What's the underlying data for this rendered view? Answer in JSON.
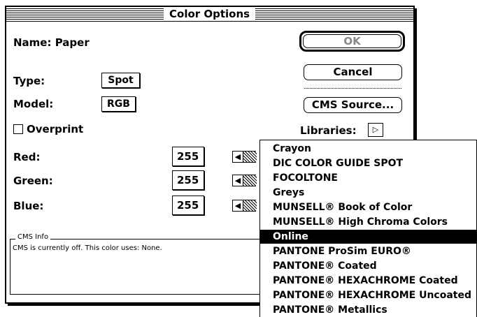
{
  "window": {
    "title": "Color Options"
  },
  "name": {
    "label": "Name: Paper"
  },
  "type": {
    "label": "Type:",
    "value": "Spot"
  },
  "model": {
    "label": "Model:",
    "value": "RGB"
  },
  "overprint": {
    "label": "Overprint",
    "checked": false
  },
  "channels": [
    {
      "label": "Red:",
      "value": "255"
    },
    {
      "label": "Green:",
      "value": "255"
    },
    {
      "label": "Blue:",
      "value": "255"
    }
  ],
  "buttons": {
    "ok": "OK",
    "cancel": "Cancel",
    "cms_source": "CMS Source..."
  },
  "libraries": {
    "label": "Libraries:"
  },
  "cms_info": {
    "legend": "CMS Info",
    "text": "CMS is currently off. This color uses: None."
  },
  "menu": {
    "selected_index": 6,
    "items": [
      "Crayon",
      "DIC COLOR GUIDE SPOT",
      "FOCOLTONE",
      "Greys",
      "MUNSELL® Book of Color",
      "MUNSELL® High Chroma Colors",
      "Online",
      "PANTONE ProSim EURO®",
      "PANTONE® Coated",
      "PANTONE® HEXACHROME Coated",
      "PANTONE® HEXACHROME Uncoated",
      "PANTONE® Metallics"
    ]
  },
  "colors": {
    "foreground": "#000000",
    "background": "#ffffff",
    "menu_highlight": "#000000"
  }
}
